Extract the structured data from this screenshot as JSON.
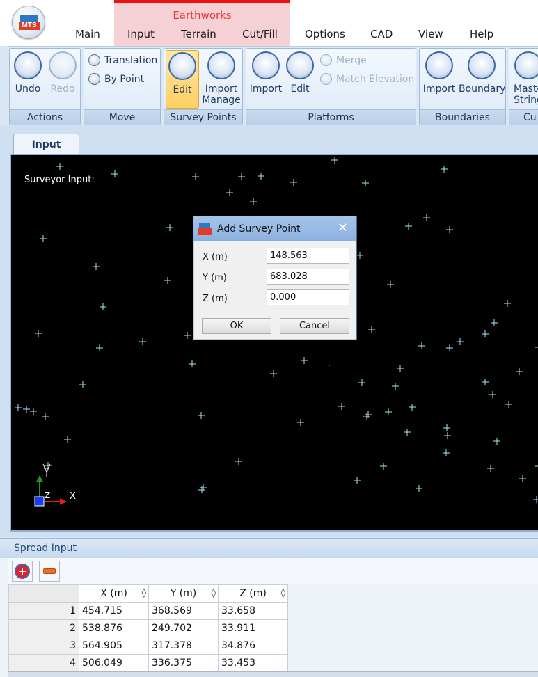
{
  "app": {
    "context_group": "Earthworks",
    "tabs": [
      "Main",
      "Input",
      "Terrain",
      "Cut/Fill",
      "Options",
      "CAD",
      "View",
      "Help"
    ]
  },
  "ribbon": {
    "actions": {
      "label": "Actions",
      "undo": "Undo",
      "redo": "Redo"
    },
    "move": {
      "label": "Move",
      "translation": "Translation",
      "by_point": "By Point"
    },
    "survey_points": {
      "label": "Survey Points",
      "edit": "Edit",
      "import_line1": "Import",
      "import_line2": "Manage"
    },
    "platforms": {
      "label": "Platforms",
      "import": "Import",
      "edit": "Edit",
      "merge": "Merge",
      "match_elevation": "Match Elevation"
    },
    "boundaries": {
      "label": "Boundaries",
      "import": "Import",
      "boundary": "Boundary"
    },
    "cut": {
      "label_partial": "Cu",
      "master_line1": "Maste",
      "master_line2": "String"
    }
  },
  "document": {
    "tab": "Input",
    "viewport_label": "Surveyor Input:",
    "axis_labels": {
      "y": "Y",
      "z": "Z",
      "x": "X"
    },
    "colors": {
      "points": "#a9e5f3",
      "background": "#000000",
      "x_axis": "#e02020",
      "y_axis": "#1f9a1f",
      "origin": "#1a3cff"
    }
  },
  "dialog": {
    "title": "Add Survey Point",
    "fields": [
      {
        "label": "X (m)",
        "value": "148.563"
      },
      {
        "label": "Y (m)",
        "value": "683.028"
      },
      {
        "label": "Z (m)",
        "value": "0.000"
      }
    ],
    "ok": "OK",
    "cancel": "Cancel"
  },
  "spread": {
    "title": "Spread Input",
    "columns": [
      "X (m)",
      "Y (m)",
      "Z (m)"
    ],
    "rows": [
      [
        "1",
        "454.715",
        "368.569",
        "33.658"
      ],
      [
        "2",
        "538.876",
        "249.702",
        "33.911"
      ],
      [
        "3",
        "564.905",
        "317.378",
        "34.876"
      ],
      [
        "4",
        "506.049",
        "336.375",
        "33.453"
      ]
    ]
  }
}
